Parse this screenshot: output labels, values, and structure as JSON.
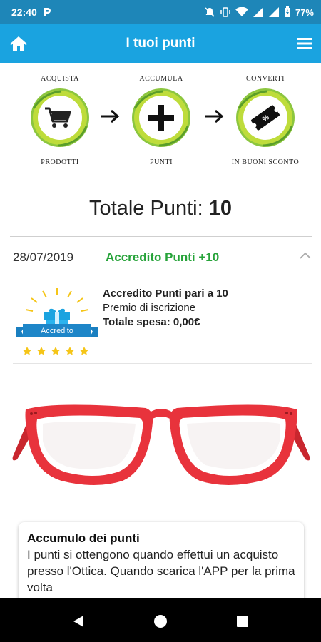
{
  "status_bar": {
    "time": "22:40",
    "battery": "77%"
  },
  "app_bar": {
    "title": "I tuoi punti"
  },
  "steps": [
    {
      "top": "ACQUISTA",
      "bottom": "PRODOTTI",
      "icon": "cart-icon"
    },
    {
      "top": "ACCUMULA",
      "bottom": "PUNTI",
      "icon": "plus-icon"
    },
    {
      "top": "CONVERTI",
      "bottom": "IN BUONI SCONTO",
      "icon": "coupon-icon"
    }
  ],
  "total": {
    "label": "Totale Punti:",
    "value": "10"
  },
  "entry": {
    "date": "28/07/2019",
    "label": "Accredito Punti +10",
    "badge_text": "Accredito",
    "line1": "Accredito Punti pari a 10",
    "line2": "Premio di iscrizione",
    "line3": "Totale spesa: 0,00€"
  },
  "card": {
    "title": "Accumulo dei punti",
    "text": "I punti si ottengono quando effettui un acquisto presso l'Ottica. Quando scarica l'APP per la prima volta"
  },
  "colors": {
    "status_bar": "#1e86b8",
    "app_bar": "#1aa3e0",
    "accent_green": "#27a33a",
    "glasses_red": "#e8333c"
  }
}
